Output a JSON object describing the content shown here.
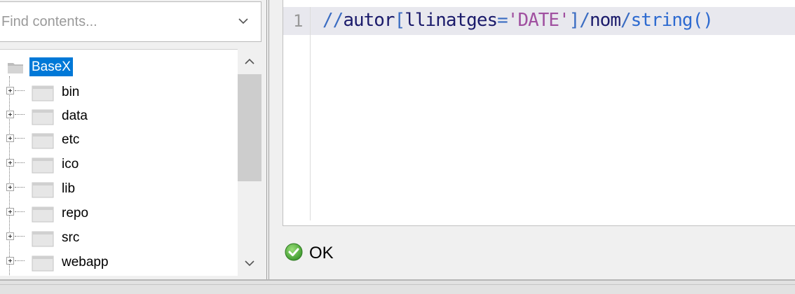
{
  "search": {
    "placeholder": "Find contents..."
  },
  "tree": {
    "root": "BaseX",
    "items": [
      {
        "label": "bin"
      },
      {
        "label": "data"
      },
      {
        "label": "etc"
      },
      {
        "label": "ico"
      },
      {
        "label": "lib"
      },
      {
        "label": "repo"
      },
      {
        "label": "src"
      },
      {
        "label": "webapp"
      }
    ]
  },
  "editor": {
    "line_number": "1",
    "tokens": {
      "slashes": "//",
      "name1": "autor",
      "lbracket": "[",
      "name2": "llinatges",
      "eq": "=",
      "str": "'DATE'",
      "rbracket": "]",
      "slash": "/",
      "name3": "nom",
      "slash2": "/",
      "fn": "string()"
    }
  },
  "status": {
    "label": "OK",
    "icon": "check-circle-icon",
    "color": "#4caf50"
  },
  "icons": {
    "dropdown": "chevron-down-icon",
    "folder": "folder-icon",
    "scroll_up": "chevron-up-icon",
    "scroll_down": "chevron-down-icon"
  },
  "colors": {
    "selection": "#0078d7",
    "line_highlight": "#e8e8ee"
  }
}
